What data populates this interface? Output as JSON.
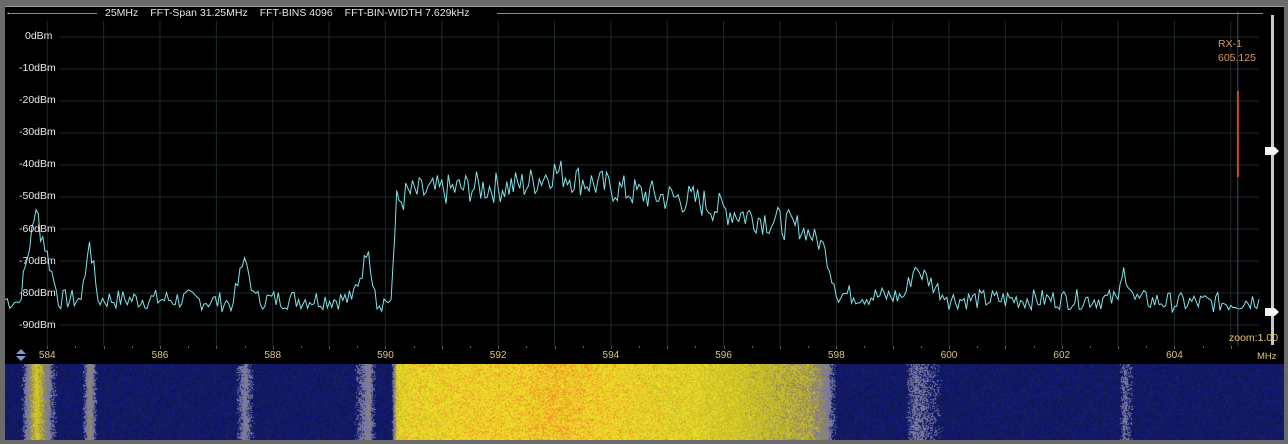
{
  "info": {
    "sample_rate": "25MHz",
    "fft_span": "FFT-Span 31.25MHz",
    "fft_bins": "FFT-BINS 4096",
    "fft_bin_width": "FFT-BIN-WIDTH 7.629kHz"
  },
  "icons": {
    "back": "back-arrow-icon",
    "updown": "up-down-arrows-icon"
  },
  "y_axis": {
    "labels": [
      "0dBm",
      "-10dBm",
      "-20dBm",
      "-30dBm",
      "-40dBm",
      "-50dBm",
      "-60dBm",
      "-70dBm",
      "-80dBm",
      "-90dBm"
    ],
    "values": [
      0,
      -10,
      -20,
      -30,
      -40,
      -50,
      -60,
      -70,
      -80,
      -90
    ]
  },
  "x_axis": {
    "labels": [
      "584",
      "586",
      "588",
      "590",
      "592",
      "594",
      "596",
      "598",
      "600",
      "602",
      "604"
    ],
    "values": [
      584,
      586,
      588,
      590,
      592,
      594,
      596,
      598,
      600,
      602,
      604
    ],
    "unit": "MHz",
    "range_mhz": [
      583.25,
      605.5
    ]
  },
  "receiver": {
    "name": "RX-1",
    "frequency": "605.125",
    "frequency_mhz": 605.125
  },
  "zoom": "zoom:1.00",
  "colors": {
    "trace": "#7fe3e8",
    "grid": "#1e2a2a",
    "rx_marker": "#d0443a",
    "label": "#d8c47a"
  },
  "chart_data": {
    "type": "line",
    "xlabel": "MHz",
    "ylabel": "",
    "ylim": [
      -95,
      3
    ],
    "xlim": [
      583.25,
      605.5
    ],
    "series": [
      {
        "name": "",
        "x": [
          583.25,
          583.5,
          583.8,
          584.2,
          584.6,
          584.75,
          584.9,
          585.5,
          586.5,
          587.3,
          587.5,
          587.7,
          588.5,
          589.4,
          589.7,
          589.85,
          590.1,
          590.2,
          590.4,
          591.0,
          591.5,
          592.0,
          592.5,
          593.0,
          593.5,
          594.0,
          594.5,
          595.0,
          595.5,
          596.0,
          596.5,
          597.0,
          597.5,
          597.8,
          598.0,
          598.5,
          599.2,
          599.4,
          600.0,
          601.0,
          602.0,
          603.0,
          603.1,
          603.3,
          604.0,
          605.0,
          605.5
        ],
        "y": [
          -82,
          -83,
          -54,
          -82,
          -82,
          -64,
          -82,
          -82,
          -82,
          -83,
          -69,
          -82,
          -82,
          -82,
          -67,
          -83,
          -82,
          -52,
          -49,
          -48,
          -47,
          -47,
          -46,
          -42,
          -45,
          -47,
          -49,
          -50,
          -51,
          -54,
          -56,
          -58,
          -61,
          -66,
          -80,
          -81,
          -81,
          -72,
          -82,
          -82,
          -82,
          -82,
          -72,
          -82,
          -83,
          -83,
          -82
        ]
      }
    ],
    "markers": [
      {
        "label": "RX-1",
        "x": 605.125
      }
    ]
  }
}
